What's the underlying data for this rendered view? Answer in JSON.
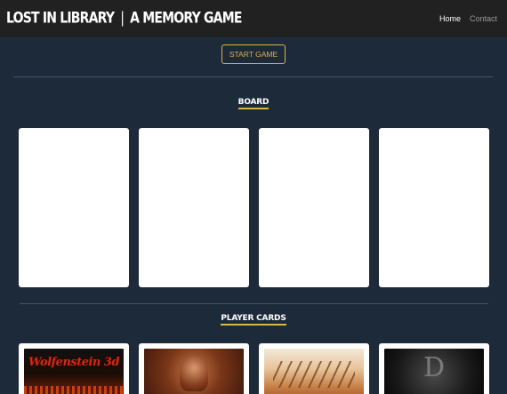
{
  "navbar": {
    "brand_left": "LOST IN LIBRARY",
    "brand_separator": "|",
    "brand_right": "A MEMORY GAME",
    "links": [
      {
        "label": "Home",
        "active": true
      },
      {
        "label": "Contact",
        "active": false
      }
    ]
  },
  "controls": {
    "start_label": "START GAME"
  },
  "board": {
    "title": "BOARD",
    "cards": [
      {
        "state": "face-down"
      },
      {
        "state": "face-down"
      },
      {
        "state": "face-down"
      },
      {
        "state": "face-down"
      }
    ]
  },
  "player_cards": {
    "title": "PLAYER CARDS",
    "cards": [
      {
        "art": "wolfenstein-3d-cover",
        "art_text": "Wolfenstein 3d"
      },
      {
        "art": "warrior-portrait"
      },
      {
        "art": "desert-battle-scene"
      },
      {
        "art": "dark-letter-logo",
        "art_text": "D"
      }
    ]
  },
  "colors": {
    "background": "#1c2a3a",
    "navbar": "#212121",
    "accent": "#e0b24a",
    "card": "#ffffff"
  }
}
